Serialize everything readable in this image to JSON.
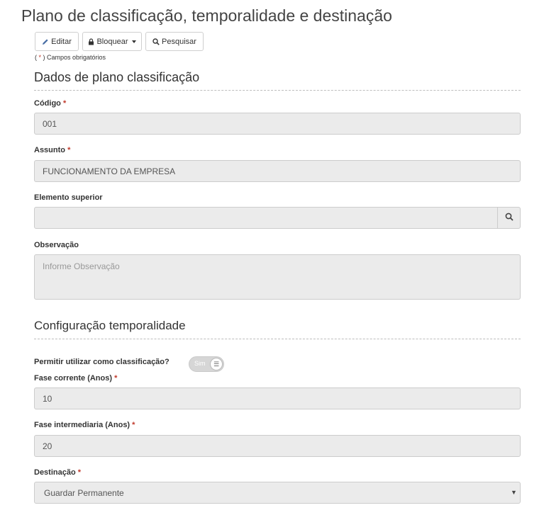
{
  "page": {
    "title": "Plano de classificação, temporalidade e destinação"
  },
  "toolbar": {
    "edit_label": "Editar",
    "lock_label": "Bloquear",
    "search_label": "Pesquisar"
  },
  "required_note": {
    "prefix": "( ",
    "asterisk": "*",
    "suffix": " ) Campos obrigatórios"
  },
  "sections": {
    "plan_data": "Dados de plano classificação",
    "temporality": "Configuração temporalidade"
  },
  "form": {
    "codigo": {
      "label": "Código",
      "required": "*",
      "value": "001"
    },
    "assunto": {
      "label": "Assunto",
      "required": "*",
      "value": "FUNCIONAMENTO DA EMPRESA"
    },
    "elemento_superior": {
      "label": "Elemento superior",
      "value": ""
    },
    "observacao": {
      "label": "Observação",
      "placeholder": "Informe Observação"
    },
    "permitir": {
      "label": "Permitir utilizar como classificação?",
      "toggle_text": "Sim",
      "toggle_state": "on"
    },
    "fase_corrente": {
      "label": "Fase corrente (Anos)",
      "required": "*",
      "value": "10"
    },
    "fase_intermediaria": {
      "label": "Fase intermediaria (Anos)",
      "required": "*",
      "value": "20"
    },
    "destinacao": {
      "label": "Destinação",
      "required": "*",
      "value": "Guardar Permanente"
    }
  },
  "colors": {
    "required": "#c0392b",
    "field_bg": "#ebebeb",
    "border": "#cccccc"
  },
  "icons": [
    "pencil-icon",
    "lock-icon",
    "search-icon",
    "caret-down-icon"
  ]
}
